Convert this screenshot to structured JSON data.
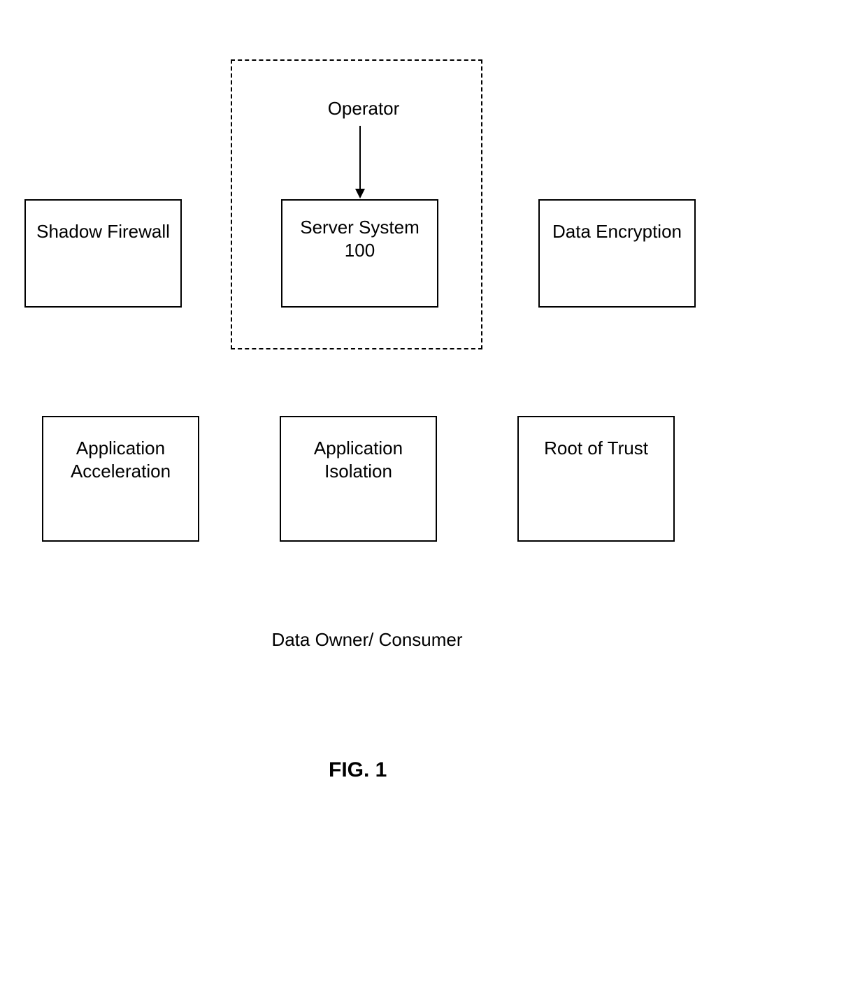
{
  "operator_label": "Operator",
  "boxes": {
    "shadow_firewall": "Shadow Firewall",
    "server_system_line1": "Server System",
    "server_system_line2": "100",
    "data_encryption": "Data Encryption",
    "app_accel_line1": "Application",
    "app_accel_line2": "Acceleration",
    "app_iso_line1": "Application",
    "app_iso_line2": "Isolation",
    "root_of_trust": "Root of Trust"
  },
  "footer_label": "Data Owner/ Consumer",
  "figure_title": "FIG. 1"
}
